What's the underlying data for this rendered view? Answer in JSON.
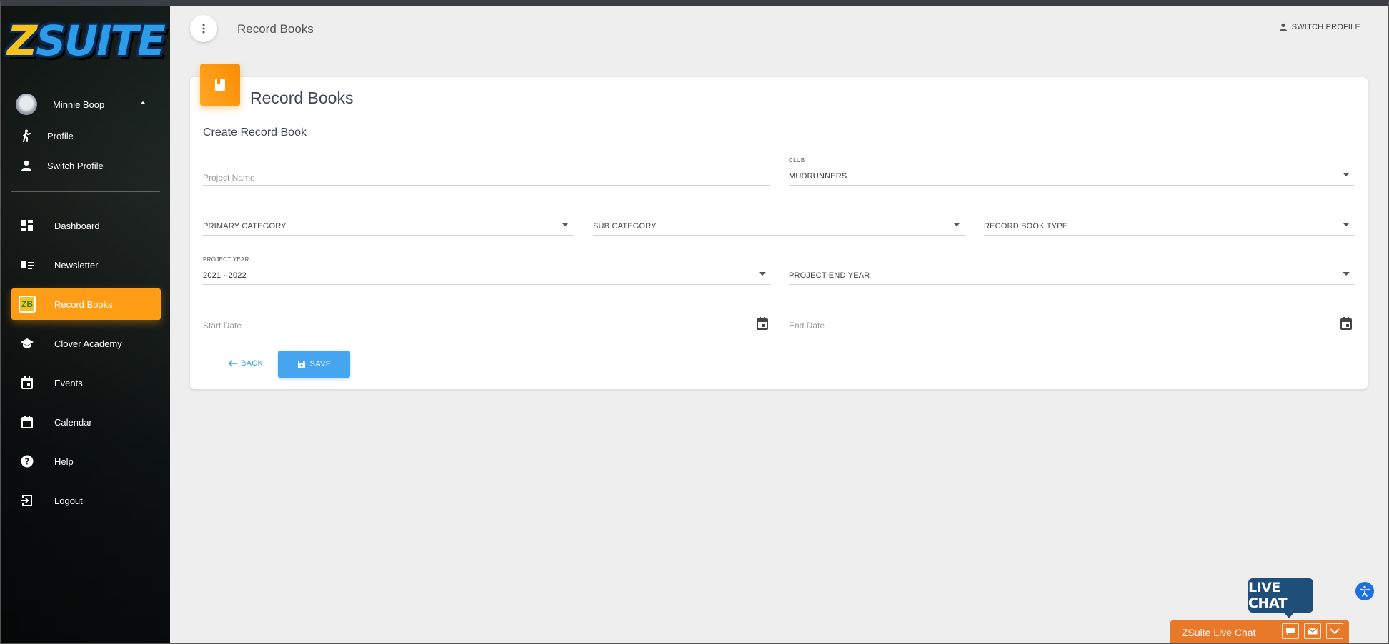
{
  "app": {
    "logo_text": "ZSUITE",
    "logo_initial": "Z",
    "logo_rest": "SUITE"
  },
  "sidebar": {
    "user": {
      "name": "Minnie Boop"
    },
    "user_menu": [
      {
        "label": "Profile",
        "icon": "person-walking-icon"
      },
      {
        "label": "Switch Profile",
        "icon": "person-icon"
      }
    ],
    "items": [
      {
        "label": "Dashboard",
        "icon": "dashboard-icon"
      },
      {
        "label": "Newsletter",
        "icon": "newsletter-icon"
      },
      {
        "label": "Record Books",
        "icon": "zb-icon",
        "badge": "ZB",
        "active": true
      },
      {
        "label": "Clover Academy",
        "icon": "school-icon"
      },
      {
        "label": "Events",
        "icon": "event-icon"
      },
      {
        "label": "Calendar",
        "icon": "calendar-icon"
      },
      {
        "label": "Help",
        "icon": "help-icon"
      },
      {
        "label": "Logout",
        "icon": "logout-icon"
      }
    ]
  },
  "header": {
    "title": "Record Books",
    "switch_profile": "SWITCH PROFILE"
  },
  "card": {
    "title": "Record Books",
    "subtitle": "Create Record Book",
    "fields": {
      "project_name": {
        "placeholder": "Project Name",
        "value": ""
      },
      "club": {
        "label": "CLUB",
        "value": "MUDRUNNERS"
      },
      "primary_category": {
        "label": "PRIMARY CATEGORY"
      },
      "sub_category": {
        "label": "SUB CATEGORY"
      },
      "record_book_type": {
        "label": "RECORD BOOK TYPE"
      },
      "project_year": {
        "label": "PROJECT YEAR",
        "value": "2021 - 2022"
      },
      "project_end_year": {
        "label": "PROJECT END YEAR"
      },
      "start_date": {
        "placeholder": "Start Date"
      },
      "end_date": {
        "placeholder": "End Date"
      }
    },
    "buttons": {
      "back": "BACK",
      "save": "SAVE"
    }
  },
  "live_chat": {
    "bubble": "LIVE CHAT",
    "bar_title": "ZSuite Live Chat"
  },
  "colors": {
    "accent_orange": "#ff9e16",
    "save_blue": "#45a5ef",
    "livechat_orange": "#e8792a",
    "livechat_navy": "#1f4e79"
  }
}
